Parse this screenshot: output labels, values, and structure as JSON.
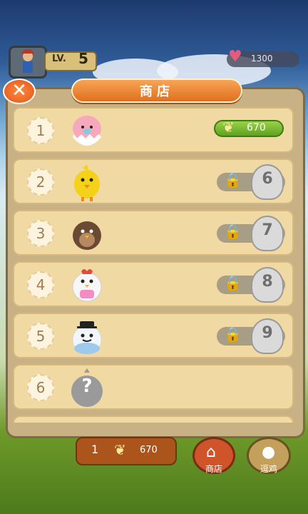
{
  "header": {
    "level_label": "LV.",
    "level_value": "5",
    "hearts_value": "1300"
  },
  "shop": {
    "title": "商店",
    "close_icon": "close-icon",
    "items": [
      {
        "number": "1",
        "bird": "pink-egg-chick",
        "price": "670",
        "locked": false
      },
      {
        "number": "2",
        "bird": "yellow-chick",
        "unlock_level": "6",
        "locked": true
      },
      {
        "number": "3",
        "bird": "brown-sparrow",
        "unlock_level": "7",
        "locked": true
      },
      {
        "number": "4",
        "bird": "white-hen-pink-apron",
        "unlock_level": "8",
        "locked": true
      },
      {
        "number": "5",
        "bird": "blue-bird-top-hat",
        "unlock_level": "9",
        "locked": true
      },
      {
        "number": "6",
        "bird": "mystery-bird",
        "mystery_mark": "?",
        "locked": true
      }
    ]
  },
  "bottom_bar": {
    "coin_count": "1",
    "coin_value": "670",
    "shop_label": "商店",
    "play_label": "逗鸡"
  }
}
